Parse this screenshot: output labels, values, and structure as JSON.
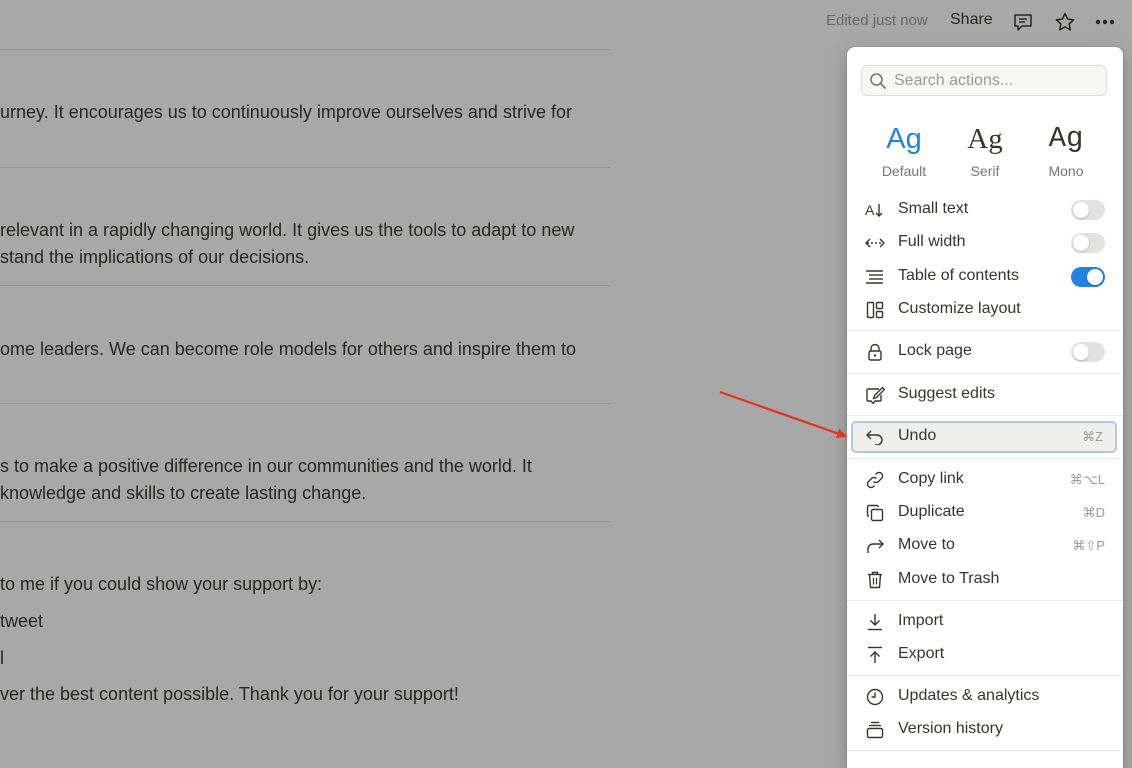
{
  "page": {
    "lines": [
      "urney. It encourages us to continuously improve ourselves and strive for",
      "relevant in a rapidly changing world. It gives us the tools to adapt to new",
      "stand the implications of our decisions.",
      "ome leaders. We can become role models for others and inspire them to",
      "s to make a positive difference in our communities and the world. It",
      " knowledge and skills to create lasting change.",
      " to me if you could show your support by:",
      "tweet",
      "l",
      "ver the best content possible. Thank you for your support!"
    ]
  },
  "topbar": {
    "edited": "Edited just now",
    "share": "Share",
    "icons": [
      "comment-icon",
      "star-icon",
      "more-icon"
    ]
  },
  "menu": {
    "search_placeholder": "Search actions...",
    "fonts": [
      {
        "ag": "Ag",
        "label": "Default",
        "active": true
      },
      {
        "ag": "Ag",
        "label": "Serif",
        "active": false
      },
      {
        "ag": "Ag",
        "label": "Mono",
        "active": false
      }
    ],
    "items": {
      "small_text": {
        "label": "Small text",
        "toggle": false
      },
      "full_width": {
        "label": "Full width",
        "toggle": false
      },
      "toc": {
        "label": "Table of contents",
        "toggle": true
      },
      "customize": {
        "label": "Customize layout"
      },
      "lock": {
        "label": "Lock page",
        "toggle": false
      },
      "suggest": {
        "label": "Suggest edits"
      },
      "undo": {
        "label": "Undo",
        "shortcut": "⌘Z"
      },
      "copy_link": {
        "label": "Copy link",
        "shortcut": "⌘⌥L"
      },
      "duplicate": {
        "label": "Duplicate",
        "shortcut": "⌘D"
      },
      "move_to": {
        "label": "Move to",
        "shortcut": "⌘⇧P"
      },
      "trash": {
        "label": "Move to Trash"
      },
      "import": {
        "label": "Import"
      },
      "export": {
        "label": "Export"
      },
      "updates": {
        "label": "Updates & analytics"
      },
      "version": {
        "label": "Version history"
      }
    }
  },
  "colors": {
    "accent": "#2383e2",
    "arrow": "#e5331d",
    "highlight_border": "#a9c7ef"
  }
}
